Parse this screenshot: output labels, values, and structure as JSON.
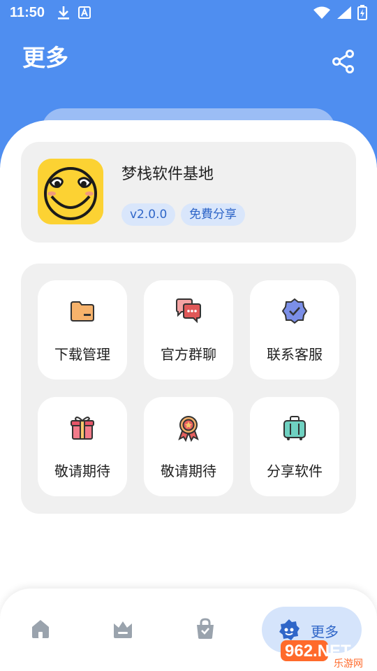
{
  "status_bar": {
    "time": "11:50",
    "left_icons": [
      "download-icon",
      "translate-a-icon"
    ],
    "right_icons": [
      "wifi-icon",
      "signal-icon",
      "battery-icon"
    ]
  },
  "header": {
    "title": "更多",
    "share_icon": "share-icon",
    "background_color": "#4f8ef0"
  },
  "app_card": {
    "name": "梦栈软件基地",
    "icon": "smiley-face-icon",
    "tags": [
      "v2.0.0",
      "免費分享"
    ]
  },
  "grid": [
    {
      "label": "下载管理",
      "icon": "folder-icon"
    },
    {
      "label": "官方群聊",
      "icon": "chat-bubbles-icon"
    },
    {
      "label": "联系客服",
      "icon": "verified-badge-icon"
    },
    {
      "label": "敬请期待",
      "icon": "gift-icon"
    },
    {
      "label": "敬请期待",
      "icon": "award-medal-icon"
    },
    {
      "label": "分享软件",
      "icon": "suitcase-icon"
    }
  ],
  "bottom_nav": {
    "items": [
      {
        "icon": "home-icon"
      },
      {
        "icon": "crown-icon"
      },
      {
        "icon": "bag-icon"
      },
      {
        "icon": "gear-face-icon",
        "label": "更多",
        "active": true
      }
    ],
    "accent_color": "#2f66c8"
  },
  "watermark": {
    "text": "962.NET",
    "subtext": "乐游网"
  }
}
